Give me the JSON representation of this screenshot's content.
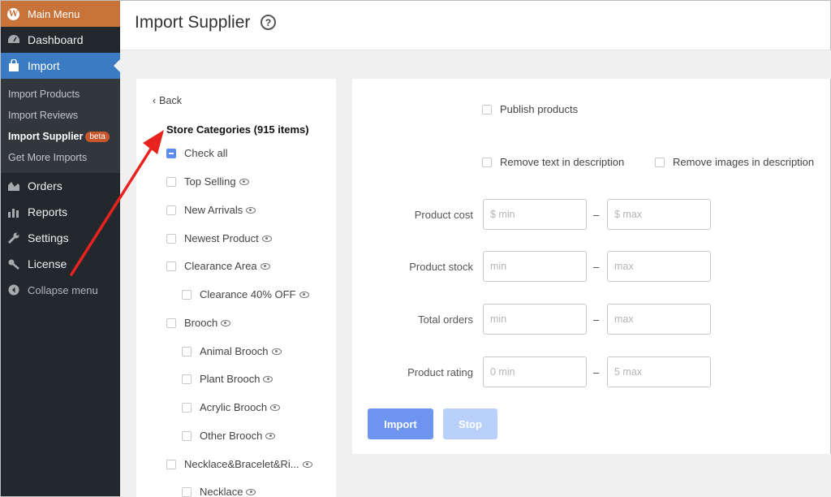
{
  "sidebar": {
    "main_menu": "Main Menu",
    "items": [
      {
        "label": "Dashboard",
        "icon": "dashboard-icon"
      },
      {
        "label": "Import",
        "icon": "bag-icon"
      }
    ],
    "submenu": [
      "Import Products",
      "Import Reviews",
      "Import Supplier",
      "Get More Imports"
    ],
    "beta_badge": "beta",
    "items_after": [
      {
        "label": "Orders",
        "icon": "chart-icon"
      },
      {
        "label": "Reports",
        "icon": "bar-chart-icon"
      },
      {
        "label": "Settings",
        "icon": "wrench-icon"
      },
      {
        "label": "License",
        "icon": "key-icon"
      }
    ],
    "collapse": "Collapse menu"
  },
  "header": {
    "title": "Import Supplier",
    "help": "?"
  },
  "categories": {
    "back": "Back",
    "title": "Store Categories (915 items)",
    "check_all": "Check all",
    "items": [
      {
        "label": "Top Selling",
        "indent": 0
      },
      {
        "label": "New Arrivals",
        "indent": 0
      },
      {
        "label": "Newest Product",
        "indent": 0
      },
      {
        "label": "Clearance Area",
        "indent": 0
      },
      {
        "label": "Clearance 40% OFF",
        "indent": 1
      },
      {
        "label": "Brooch",
        "indent": 0
      },
      {
        "label": "Animal Brooch",
        "indent": 1
      },
      {
        "label": "Plant Brooch",
        "indent": 1
      },
      {
        "label": "Acrylic Brooch",
        "indent": 1
      },
      {
        "label": "Other Brooch",
        "indent": 1
      },
      {
        "label": "Necklace&Bracelet&Ri...",
        "indent": 0
      },
      {
        "label": "Necklace",
        "indent": 1
      }
    ]
  },
  "options": {
    "publish": "Publish products",
    "remove_text": "Remove text in description",
    "remove_images": "Remove images in description"
  },
  "filters": {
    "cost_label": "Product cost",
    "cost_min": "$ min",
    "cost_max": "$ max",
    "stock_label": "Product stock",
    "stock_min": "min",
    "stock_max": "max",
    "orders_label": "Total orders",
    "orders_min": "min",
    "orders_max": "max",
    "rating_label": "Product rating",
    "rating_min": "0 min",
    "rating_max": "5 max",
    "separator": "–"
  },
  "buttons": {
    "import": "Import",
    "stop": "Stop"
  },
  "colors": {
    "accent": "#3a7bc3",
    "main_menu": "#c8733a",
    "annotation_arrow": "#e8231f"
  }
}
